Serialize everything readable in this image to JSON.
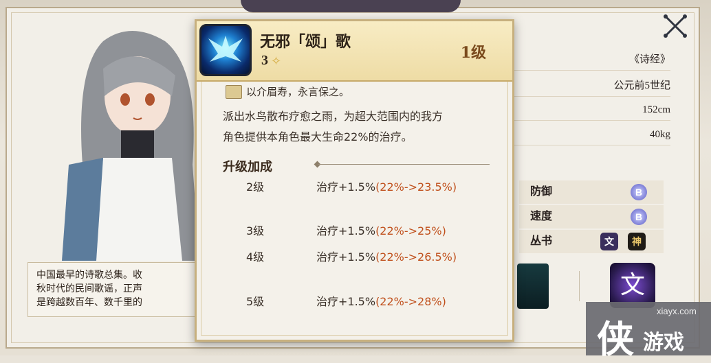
{
  "colors": {
    "accent_orange": "#c0501c",
    "panel_bg": "#f2efe8",
    "popup_border": "#c7b07e",
    "grade_purple": "#7d7ed6"
  },
  "close_icon": "close-x-icon",
  "character": {
    "description_lines": [
      "中国最早的诗歌总集。收",
      "秋时代的民间歌谣，正声",
      "是跨越数百年、数千里的"
    ]
  },
  "info": {
    "source": "《诗经》",
    "era": "公元前5世纪",
    "height": "152cm",
    "weight": "40kg"
  },
  "stats": [
    {
      "label": "防御",
      "grade": "B"
    },
    {
      "label": "速度",
      "grade": "B"
    }
  ],
  "series": {
    "label": "丛书",
    "tags": [
      "文",
      "神"
    ]
  },
  "skill_icons": {
    "wen": "文"
  },
  "watermark": {
    "url": "xiayx.com",
    "big": "侠",
    "text": "游戏"
  },
  "popup": {
    "skill_name": "无邪「颂」歌",
    "cost": "3",
    "level": "1级",
    "quote": "以介眉寿，永言保之。",
    "effect_lines": [
      "派出水鸟散布疗愈之雨，为超大范围内的我方",
      "角色提供本角色最大生命22%的治疗。"
    ],
    "upgrade_title": "升级加成",
    "upgrades": [
      {
        "level": "2级",
        "effect": "治疗+1.5%",
        "change": "(22%->23.5%)"
      },
      {
        "level": "3级",
        "effect": "治疗+1.5%",
        "change": "(22%->25%)"
      },
      {
        "level": "4级",
        "effect": "治疗+1.5%",
        "change": "(22%->26.5%)"
      },
      {
        "level": "5级",
        "effect": "治疗+1.5%",
        "change": "(22%->28%)"
      }
    ]
  }
}
